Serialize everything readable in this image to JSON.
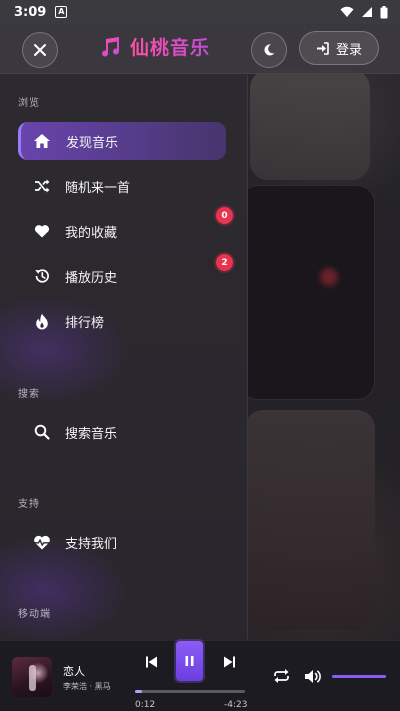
{
  "status_bar": {
    "time": "3:09",
    "a_icon": "A"
  },
  "header": {
    "app_title": "仙桃音乐",
    "login_label": "登录"
  },
  "drawer": {
    "browse_section": "浏览",
    "items": [
      {
        "label": "发现音乐",
        "icon": "home-icon",
        "active": true
      },
      {
        "label": "随机来一首",
        "icon": "shuffle-icon"
      },
      {
        "label": "我的收藏",
        "icon": "heart-icon",
        "badge": "0"
      },
      {
        "label": "播放历史",
        "icon": "history-icon",
        "badge": "2"
      },
      {
        "label": "排行榜",
        "icon": "fire-icon"
      }
    ],
    "search_section": "搜索",
    "search_item": "搜索音乐",
    "support_section": "支持",
    "support_item": "支持我们",
    "mobile_section": "移动端"
  },
  "player": {
    "song_title": "恋人",
    "artist_album": "李荣浩 · 黑马",
    "elapsed": "0:12",
    "remaining": "-4:23",
    "progress_fraction": 0.06,
    "volume_fraction": 1.0,
    "state": "playing"
  },
  "colors": {
    "accent": "#8b5cf6",
    "brand_gradient_start": "#ff4fa3",
    "badge": "#e8344e"
  }
}
